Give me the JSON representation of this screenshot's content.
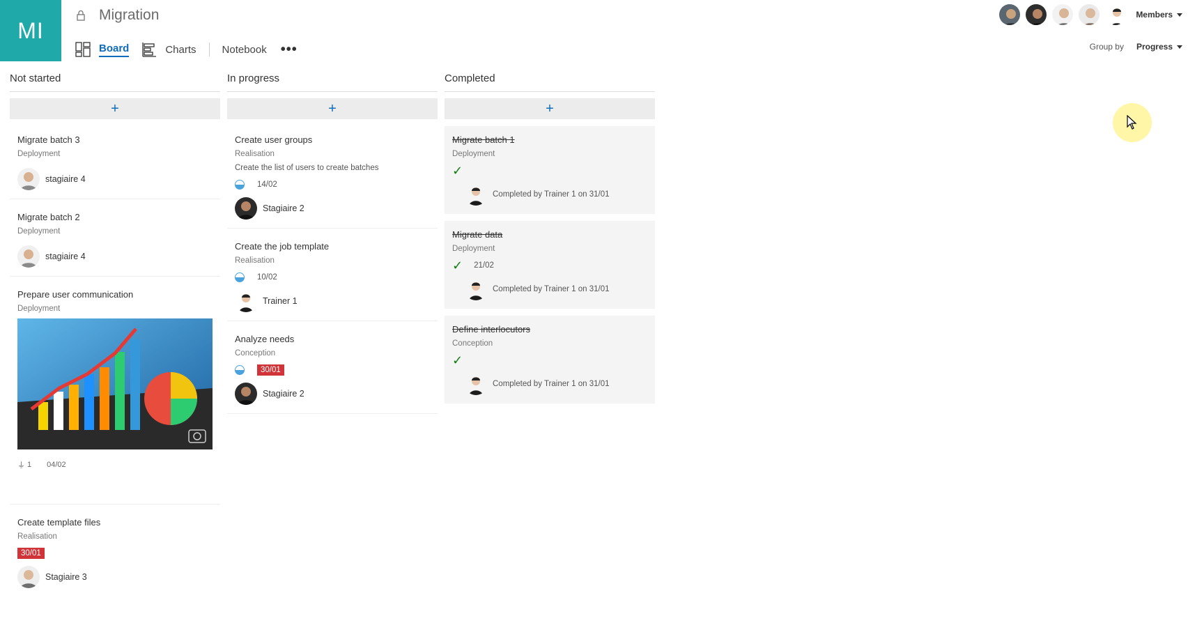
{
  "plan": {
    "initials": "MI",
    "title": "Migration"
  },
  "nav": {
    "board": "Board",
    "charts": "Charts",
    "notebook": "Notebook",
    "more": "•••"
  },
  "header": {
    "members_label": "Members",
    "group_by_label": "Group by",
    "group_by_value": "Progress"
  },
  "columns": {
    "not_started": {
      "title": "Not started",
      "add": "+",
      "cards": [
        {
          "title": "Migrate batch 3",
          "bucket": "Deployment",
          "assignee": "stagiaire 4"
        },
        {
          "title": "Migrate batch 2",
          "bucket": "Deployment",
          "assignee": "stagiaire 4"
        },
        {
          "title": "Prepare user communication",
          "bucket": "Deployment",
          "attachments": "1",
          "date": "04/02"
        },
        {
          "title": "Create template files",
          "bucket": "Realisation",
          "date": "30/01",
          "assignee": "Stagiaire 3"
        }
      ]
    },
    "in_progress": {
      "title": "In progress",
      "add": "+",
      "cards": [
        {
          "title": "Create user groups",
          "bucket": "Realisation",
          "description": "Create the list of users to create batches",
          "date": "14/02",
          "assignee": "Stagiaire 2"
        },
        {
          "title": "Create the job template",
          "bucket": "Realisation",
          "date": "10/02",
          "assignee": "Trainer 1"
        },
        {
          "title": "Analyze needs",
          "bucket": "Conception",
          "date": "30/01",
          "assignee": "Stagiaire 2"
        }
      ]
    },
    "completed": {
      "title": "Completed",
      "add": "+",
      "cards": [
        {
          "title": "Migrate batch 1",
          "bucket": "Deployment",
          "completed_by": "Completed by Trainer 1 on 31/01"
        },
        {
          "title": "Migrate data",
          "bucket": "Deployment",
          "date": "21/02",
          "completed_by": "Completed by Trainer 1 on 31/01"
        },
        {
          "title": "Define interlocutors",
          "bucket": "Conception",
          "completed_by": "Completed by Trainer 1 on 31/01"
        }
      ]
    }
  },
  "colors": {
    "accent": "#0f6cbd",
    "tile": "#1fa9a9",
    "overdue": "#d13438",
    "check": "#107c10"
  }
}
